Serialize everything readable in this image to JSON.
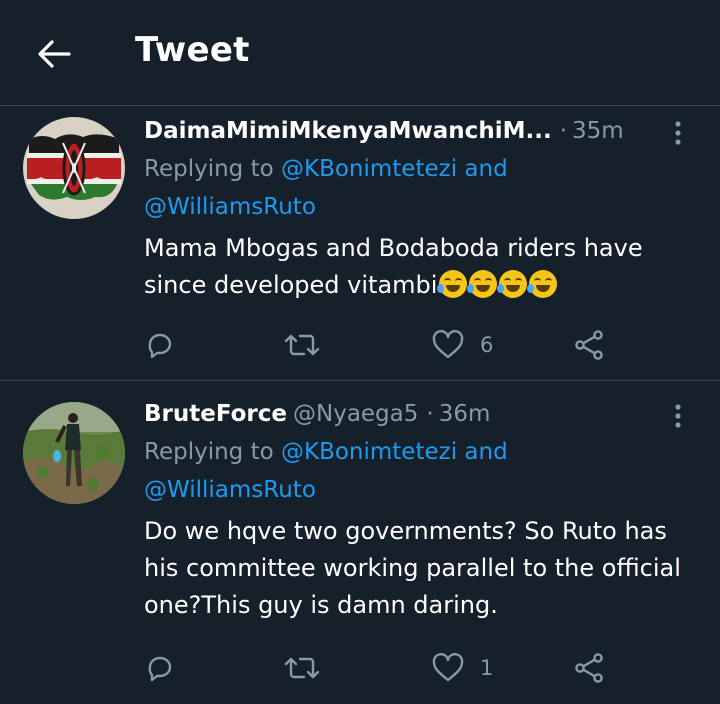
{
  "header": {
    "title": "Tweet"
  },
  "tweets": [
    {
      "name": "DaimaMimiMkenyaMwanchiM...",
      "handle": "",
      "time": "35m",
      "replying_prefix": "Replying to ",
      "mention1": "@KBonimtetezi",
      "and": " and",
      "mention2": "@WilliamsRuto",
      "body": "Mama Mbogas and Bodaboda riders have since developed vitambi",
      "emoji_count": 4,
      "likes": "6"
    },
    {
      "name": "BruteForce",
      "handle": "@Nyaega5",
      "time": "36m",
      "replying_prefix": "Replying to ",
      "mention1": "@KBonimtetezi",
      "and": " and",
      "mention2": "@WilliamsRuto",
      "body": "Do we hqve two governments? So Ruto has his committee working parallel to the official one?This guy is damn daring.",
      "likes": "1"
    }
  ],
  "colors": {
    "background": "#15202b",
    "muted": "#8b98a5",
    "link": "#1d9bf0",
    "divider": "#38444d"
  },
  "icons": [
    "back-arrow-icon",
    "more-options-icon",
    "reply-icon",
    "retweet-icon",
    "like-icon",
    "share-icon",
    "rofl-emoji"
  ]
}
